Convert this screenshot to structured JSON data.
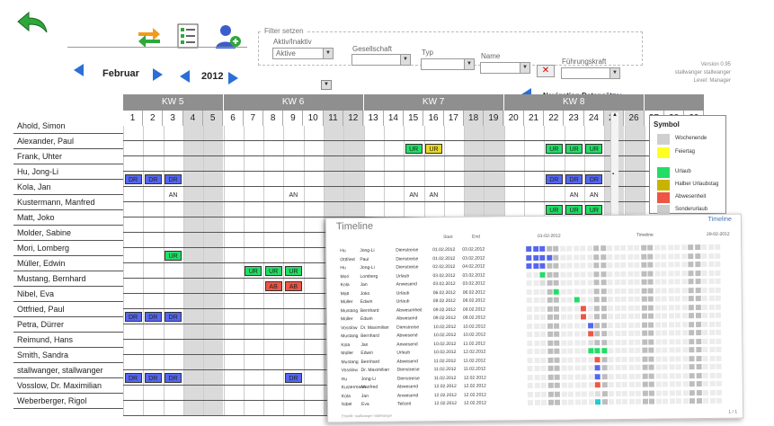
{
  "filter": {
    "title": "Filter setzen",
    "status_label": "Aktiv/Inaktiv",
    "status_value": "Aktive",
    "company_label": "Gesellschaft",
    "type_label": "Typ",
    "name_label": "Name",
    "manager_label": "Führungskraft"
  },
  "version": {
    "line1": "Version 0.95",
    "line2": "stallwanger stallwanger",
    "line3": "Level: Manager"
  },
  "nav": {
    "month": "Februar",
    "year": "2012",
    "datasets_label": "Navigation Datensätze"
  },
  "weeks": [
    {
      "label": "KW 5",
      "days": [
        "1",
        "2",
        "3",
        "4",
        "5"
      ]
    },
    {
      "label": "KW 6",
      "days": [
        "6",
        "7",
        "8",
        "9",
        "10",
        "11",
        "12"
      ]
    },
    {
      "label": "KW 7",
      "days": [
        "13",
        "14",
        "15",
        "16",
        "17",
        "18",
        "19"
      ]
    },
    {
      "label": "KW 8",
      "days": [
        "20",
        "21",
        "22",
        "23",
        "24",
        "25",
        "26"
      ]
    },
    {
      "label": "",
      "days": [
        "27",
        "28",
        "29"
      ]
    }
  ],
  "weekend_days": [
    4,
    5,
    11,
    12,
    18,
    19,
    25,
    26
  ],
  "employees": [
    "Ahold, Simon",
    "Alexander, Paul",
    "Frank, Uhter",
    "Hu, Jong-Li",
    "Kola, Jan",
    "Kustermann, Manfred",
    "Matt, Joko",
    "Molder, Sabine",
    "Mori, Lomberg",
    "Müller, Edwin",
    "Mustang, Bernhard",
    "Nibel, Eva",
    "Ottfried, Paul",
    "Petra, Dürrer",
    "Reimund, Hans",
    "Smith, Sandra",
    "stallwanger, stallwanger",
    "Vosslow, Dr. Maximilian",
    "Weberberger, Rigol"
  ],
  "entries": [
    {
      "row": 1,
      "day": 15,
      "code": "UR",
      "color": "#22dd66"
    },
    {
      "row": 1,
      "day": 16,
      "code": "UR",
      "color": "#e8d820"
    },
    {
      "row": 1,
      "day": 22,
      "code": "UR",
      "color": "#22dd66"
    },
    {
      "row": 1,
      "day": 23,
      "code": "UR",
      "color": "#22dd66"
    },
    {
      "row": 1,
      "day": 24,
      "code": "UR",
      "color": "#22dd66"
    },
    {
      "row": 3,
      "day": 1,
      "code": "DR",
      "color": "#5566ee"
    },
    {
      "row": 3,
      "day": 2,
      "code": "DR",
      "color": "#5566ee"
    },
    {
      "row": 3,
      "day": 3,
      "code": "DR",
      "color": "#5566ee"
    },
    {
      "row": 3,
      "day": 22,
      "code": "DR",
      "color": "#5566ee"
    },
    {
      "row": 3,
      "day": 23,
      "code": "DR",
      "color": "#5566ee"
    },
    {
      "row": 3,
      "day": 24,
      "code": "DR",
      "color": "#5566ee"
    },
    {
      "row": 4,
      "day": 3,
      "code": "AN",
      "color": "#ffffff"
    },
    {
      "row": 4,
      "day": 9,
      "code": "AN",
      "color": "#ffffff"
    },
    {
      "row": 4,
      "day": 15,
      "code": "AN",
      "color": "#ffffff"
    },
    {
      "row": 4,
      "day": 16,
      "code": "AN",
      "color": "#ffffff"
    },
    {
      "row": 4,
      "day": 23,
      "code": "AN",
      "color": "#ffffff"
    },
    {
      "row": 4,
      "day": 24,
      "code": "AN",
      "color": "#ffffff"
    },
    {
      "row": 5,
      "day": 22,
      "code": "UR",
      "color": "#22dd66"
    },
    {
      "row": 5,
      "day": 23,
      "code": "UR",
      "color": "#22dd66"
    },
    {
      "row": 5,
      "day": 24,
      "code": "UR",
      "color": "#22dd66"
    },
    {
      "row": 8,
      "day": 3,
      "code": "UR",
      "color": "#22dd66"
    },
    {
      "row": 9,
      "day": 7,
      "code": "UR",
      "color": "#22dd66"
    },
    {
      "row": 9,
      "day": 8,
      "code": "UR",
      "color": "#22dd66"
    },
    {
      "row": 9,
      "day": 9,
      "code": "UR",
      "color": "#22dd66"
    },
    {
      "row": 10,
      "day": 8,
      "code": "AB",
      "color": "#ee5544"
    },
    {
      "row": 10,
      "day": 9,
      "code": "AB",
      "color": "#ee5544"
    },
    {
      "row": 12,
      "day": 1,
      "code": "DR",
      "color": "#5566ee"
    },
    {
      "row": 12,
      "day": 2,
      "code": "DR",
      "color": "#5566ee"
    },
    {
      "row": 12,
      "day": 3,
      "code": "DR",
      "color": "#5566ee"
    },
    {
      "row": 16,
      "day": 1,
      "code": "DR",
      "color": "#5566ee"
    },
    {
      "row": 16,
      "day": 2,
      "code": "DR",
      "color": "#5566ee"
    },
    {
      "row": 16,
      "day": 3,
      "code": "DR",
      "color": "#5566ee"
    },
    {
      "row": 16,
      "day": 9,
      "code": "DR",
      "color": "#5566ee"
    }
  ],
  "legend": {
    "title": "Symbol",
    "items": [
      {
        "label": "Wochenende",
        "color": "#cfcfcf"
      },
      {
        "label": "Feiertag",
        "color": "#ffff22"
      },
      {
        "label": "Urlaub",
        "color": "#22dd66"
      },
      {
        "label": "Halber Urlaubstag",
        "color": "#c8b400"
      },
      {
        "label": "Abwesenheit",
        "color": "#ee5544"
      },
      {
        "label": "Sonderurlaub",
        "color": "#cccccc"
      }
    ]
  },
  "timeline": {
    "title": "Timeline",
    "link": "Timeline",
    "col_start": "Start",
    "col_end": "End",
    "range_start": "01-02-2012",
    "range_mid": "Timeline",
    "range_end": "29-02-2012",
    "page": "1 / 1",
    "footer": "Erstellt: stallwanger stallwanger",
    "rows": [
      {
        "last": "Hu",
        "first": "Jong-Li",
        "type": "Dienstreise",
        "start": "01.02.2012",
        "end": "03.02.2012",
        "d": 1,
        "len": 3,
        "color": "#5566ee"
      },
      {
        "last": "Ottfried",
        "first": "Paul",
        "type": "Dienstreise",
        "start": "01.02.2012",
        "end": "03.02.2012",
        "d": 1,
        "len": 4,
        "color": "#5566ee"
      },
      {
        "last": "Hu",
        "first": "Jong-Li",
        "type": "Dienstreise",
        "start": "02.02.2012",
        "end": "04.02.2012",
        "d": 1,
        "len": 3,
        "color": "#5566ee"
      },
      {
        "last": "Mori",
        "first": "Lomberg",
        "type": "Urlaub",
        "start": "03.02.2012",
        "end": "03.02.2012",
        "d": 3,
        "len": 1,
        "color": "#22dd66"
      },
      {
        "last": "Kola",
        "first": "Jan",
        "type": "Anwesend",
        "start": "03.02.2012",
        "end": "03.02.2012",
        "d": 3,
        "len": 1,
        "color": "#dddddd"
      },
      {
        "last": "Matt",
        "first": "Joko",
        "type": "Urlaub",
        "start": "06.02.2012",
        "end": "06.02.2012",
        "d": 5,
        "len": 1,
        "color": "#22dd66"
      },
      {
        "last": "Müller",
        "first": "Edwin",
        "type": "Urlaub",
        "start": "08.02.2012",
        "end": "08.02.2012",
        "d": 8,
        "len": 1,
        "color": "#22dd66"
      },
      {
        "last": "Mustang",
        "first": "Bernhard",
        "type": "Abwesenheit",
        "start": "09.02.2012",
        "end": "09.02.2012",
        "d": 9,
        "len": 1,
        "color": "#ee5544"
      },
      {
        "last": "Müller",
        "first": "Edwin",
        "type": "Abwesend",
        "start": "09.02.2012",
        "end": "09.02.2012",
        "d": 9,
        "len": 1,
        "color": "#ee5544"
      },
      {
        "last": "Vosslow",
        "first": "Dr. Maximilian",
        "type": "Dienstreise",
        "start": "10.02.2012",
        "end": "10.02.2012",
        "d": 10,
        "len": 1,
        "color": "#5566ee"
      },
      {
        "last": "Mustang",
        "first": "Bernhard",
        "type": "Abwesend",
        "start": "10.02.2012",
        "end": "10.02.2012",
        "d": 10,
        "len": 1,
        "color": "#ee5544"
      },
      {
        "last": "Kola",
        "first": "Jan",
        "type": "Anwesend",
        "start": "10.02.2012",
        "end": "11.02.2012",
        "d": 10,
        "len": 1,
        "color": "#dddddd"
      },
      {
        "last": "Müller",
        "first": "Edwin",
        "type": "Urlaub",
        "start": "10.02.2012",
        "end": "12.02.2012",
        "d": 10,
        "len": 3,
        "color": "#22dd66"
      },
      {
        "last": "Mustang",
        "first": "Bernhard",
        "type": "Abwesend",
        "start": "11.02.2012",
        "end": "11.02.2012",
        "d": 11,
        "len": 1,
        "color": "#ee5544"
      },
      {
        "last": "Vosslow",
        "first": "Dr. Maximilian",
        "type": "Dienstreise",
        "start": "11.02.2012",
        "end": "11.02.2012",
        "d": 11,
        "len": 1,
        "color": "#5566ee"
      },
      {
        "last": "Hu",
        "first": "Jong-Li",
        "type": "Dienstreise",
        "start": "11.02.2012",
        "end": "12.02.2012",
        "d": 11,
        "len": 1,
        "color": "#5566ee"
      },
      {
        "last": "Kustermann",
        "first": "Manfred",
        "type": "Abwesend",
        "start": "12.02.2012",
        "end": "12.02.2012",
        "d": 11,
        "len": 1,
        "color": "#ee5544"
      },
      {
        "last": "Kola",
        "first": "Jan",
        "type": "Anwesend",
        "start": "12.02.2012",
        "end": "12.02.2012",
        "d": 11,
        "len": 1,
        "color": "#dddddd"
      },
      {
        "last": "Nibel",
        "first": "Eva",
        "type": "Teilzeit",
        "start": "12.02.2012",
        "end": "12.02.2012",
        "d": 11,
        "len": 1,
        "color": "#22cccc"
      }
    ]
  }
}
